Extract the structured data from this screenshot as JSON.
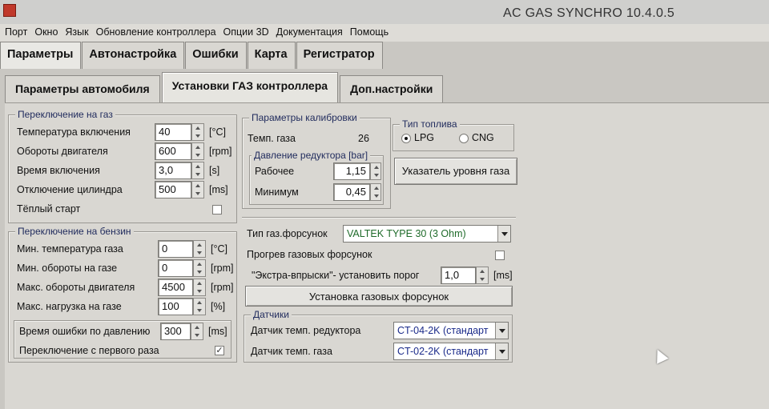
{
  "window": {
    "title": "AC GAS SYNCHRO  10.4.0.5"
  },
  "menu": [
    "Порт",
    "Окно",
    "Язык",
    "Обновление контроллера",
    "Опции 3D",
    "Документация",
    "Помощь"
  ],
  "main_tabs": [
    "Параметры",
    "Автонастройка",
    "Ошибки",
    "Карта",
    "Регистратор"
  ],
  "main_tab_active": "Параметры",
  "sub_tabs": [
    "Параметры автомобиля",
    "Установки ГАЗ контроллера",
    "Доп.настройки"
  ],
  "sub_tab_active": "Установки ГАЗ контроллера",
  "switch_gas": {
    "title": "Переключение на газ",
    "rows": [
      {
        "label": "Температура включения",
        "value": "40",
        "unit": "[°C]"
      },
      {
        "label": "Обороты двигателя",
        "value": "600",
        "unit": "[rpm]"
      },
      {
        "label": "Время включения",
        "value": "3,0",
        "unit": "[s]"
      },
      {
        "label": "Отключение цилиндра",
        "value": "500",
        "unit": "[ms]"
      }
    ],
    "warm_start": {
      "label": "Тёплый старт",
      "checked": false
    }
  },
  "switch_petrol": {
    "title": "Переключение на бензин",
    "rows": [
      {
        "label": "Мин. температура газа",
        "value": "0",
        "unit": "[°C]"
      },
      {
        "label": "Мин. обороты на газе",
        "value": "0",
        "unit": "[rpm]"
      },
      {
        "label": "Макс. обороты двигателя",
        "value": "4500",
        "unit": "[rpm]"
      },
      {
        "label": "Макс. нагрузка на газе",
        "value": "100",
        "unit": "[%]"
      }
    ],
    "pressure_error": {
      "label": "Время ошибки по давлению",
      "value": "300",
      "unit": "[ms]"
    },
    "first_time": {
      "label": "Переключение с первого раза",
      "checked": true
    }
  },
  "calibration": {
    "title": "Параметры калибровки",
    "gas_temp_label": "Темп. газа",
    "gas_temp_value": "26",
    "pressure_title": "Давление редуктора [bar]",
    "working_label": "Рабочее",
    "working_value": "1,15",
    "min_label": "Минимум",
    "min_value": "0,45"
  },
  "fuel_type": {
    "title": "Тип топлива",
    "options": [
      "LPG",
      "CNG"
    ],
    "selected": "LPG"
  },
  "gas_level_button": "Указатель уровня газа",
  "injectors": {
    "type_label": "Тип газ.форсунок",
    "type_value": "VALTEK TYPE 30 (3 Ohm)",
    "warmup_label": "Прогрев газовых форсунок",
    "warmup_checked": false,
    "extra_label": "\"Экстра-впрыски\"- установить порог",
    "extra_value": "1,0",
    "extra_unit": "[ms]",
    "install_button": "Установка газовых форсунок"
  },
  "sensors": {
    "title": "Датчики",
    "reducer_label": "Датчик темп. редуктора",
    "reducer_value": "CT-04-2K (стандарт",
    "gas_label": "Датчик темп. газа",
    "gas_value": "CT-02-2K (стандарт"
  },
  "colors": {
    "group_title": "#1f2a5c",
    "injector_value": "#1f6b2a",
    "sensor_value": "#1a2a8a"
  }
}
